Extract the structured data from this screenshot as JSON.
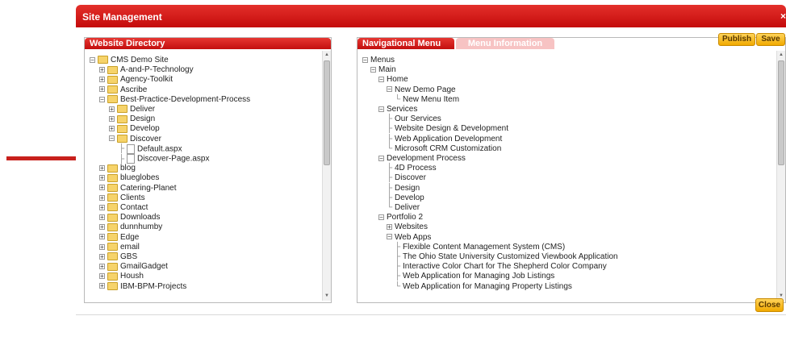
{
  "dialog": {
    "title": "Site Management",
    "close_x": "×"
  },
  "website_directory": {
    "header": "Website Directory",
    "tree": [
      {
        "label": "CMS Demo Site",
        "level": 0,
        "type": "folder",
        "exp": "−"
      },
      {
        "label": "A-and-P-Technology",
        "level": 1,
        "type": "folder",
        "exp": "+"
      },
      {
        "label": "Agency-Toolkit",
        "level": 1,
        "type": "folder",
        "exp": "+"
      },
      {
        "label": "Ascribe",
        "level": 1,
        "type": "folder",
        "exp": "+"
      },
      {
        "label": "Best-Practice-Development-Process",
        "level": 1,
        "type": "folder",
        "exp": "−"
      },
      {
        "label": "Deliver",
        "level": 2,
        "type": "folder",
        "exp": "+"
      },
      {
        "label": "Design",
        "level": 2,
        "type": "folder",
        "exp": "+"
      },
      {
        "label": "Develop",
        "level": 2,
        "type": "folder",
        "exp": "+"
      },
      {
        "label": "Discover",
        "level": 2,
        "type": "folder",
        "exp": "−"
      },
      {
        "label": "Default.aspx",
        "level": 3,
        "type": "file"
      },
      {
        "label": "Discover-Page.aspx",
        "level": 3,
        "type": "file"
      },
      {
        "label": "blog",
        "level": 1,
        "type": "folder",
        "exp": "+"
      },
      {
        "label": "blueglobes",
        "level": 1,
        "type": "folder",
        "exp": "+"
      },
      {
        "label": "Catering-Planet",
        "level": 1,
        "type": "folder",
        "exp": "+"
      },
      {
        "label": "Clients",
        "level": 1,
        "type": "folder",
        "exp": "+"
      },
      {
        "label": "Contact",
        "level": 1,
        "type": "folder",
        "exp": "+"
      },
      {
        "label": "Downloads",
        "level": 1,
        "type": "folder",
        "exp": "+"
      },
      {
        "label": "dunnhumby",
        "level": 1,
        "type": "folder",
        "exp": "+"
      },
      {
        "label": "Edge",
        "level": 1,
        "type": "folder",
        "exp": "+"
      },
      {
        "label": "email",
        "level": 1,
        "type": "folder",
        "exp": "+"
      },
      {
        "label": "GBS",
        "level": 1,
        "type": "folder",
        "exp": "+"
      },
      {
        "label": "GmailGadget",
        "level": 1,
        "type": "folder",
        "exp": "+"
      },
      {
        "label": "Housh",
        "level": 1,
        "type": "folder",
        "exp": "+"
      },
      {
        "label": "IBM-BPM-Projects",
        "level": 1,
        "type": "folder",
        "exp": "+"
      }
    ]
  },
  "nav_panel": {
    "tab_active": "Navigational Menu",
    "tab_inactive": "Menu Information",
    "tree": [
      {
        "label": "Menus",
        "level": 0,
        "exp": "−"
      },
      {
        "label": "Main",
        "level": 1,
        "exp": "−"
      },
      {
        "label": "Home",
        "level": 2,
        "exp": "−"
      },
      {
        "label": "New Demo Page",
        "level": 3,
        "exp": "−"
      },
      {
        "label": "New Menu Item",
        "level": 4,
        "leaf": true
      },
      {
        "label": "Services",
        "level": 2,
        "exp": "−"
      },
      {
        "label": "Our Services",
        "level": 3,
        "leaf": true
      },
      {
        "label": "Website Design & Development",
        "level": 3,
        "leaf": true
      },
      {
        "label": "Web Application Development",
        "level": 3,
        "leaf": true
      },
      {
        "label": "Microsoft CRM Customization",
        "level": 3,
        "leaf": true
      },
      {
        "label": "Development Process",
        "level": 2,
        "exp": "−"
      },
      {
        "label": "4D Process",
        "level": 3,
        "leaf": true
      },
      {
        "label": "Discover",
        "level": 3,
        "leaf": true
      },
      {
        "label": "Design",
        "level": 3,
        "leaf": true
      },
      {
        "label": "Develop",
        "level": 3,
        "leaf": true
      },
      {
        "label": "Deliver",
        "level": 3,
        "leaf": true
      },
      {
        "label": "Portfolio 2",
        "level": 2,
        "exp": "−"
      },
      {
        "label": "Websites",
        "level": 3,
        "exp": "+"
      },
      {
        "label": "Web Apps",
        "level": 3,
        "exp": "−"
      },
      {
        "label": "Flexible Content Management System (CMS)",
        "level": 4,
        "leaf": true
      },
      {
        "label": "The Ohio State University Customized Viewbook Application",
        "level": 4,
        "leaf": true
      },
      {
        "label": "Interactive Color Chart for The Shepherd Color Company",
        "level": 4,
        "leaf": true
      },
      {
        "label": "Web Application for Managing Job Listings",
        "level": 4,
        "leaf": true
      },
      {
        "label": "Web Application for Managing Property Listings",
        "level": 4,
        "leaf": true
      }
    ]
  },
  "buttons": {
    "publish": "Publish",
    "save": "Save",
    "close": "Close"
  },
  "colors": {
    "brand_red": "#d11a17",
    "button_gold": "#f1a900",
    "arrow_red": "#c8201c"
  },
  "icons": {
    "pointer_arrow": "arrow-right",
    "folder": "folder-icon",
    "file": "file-icon"
  }
}
